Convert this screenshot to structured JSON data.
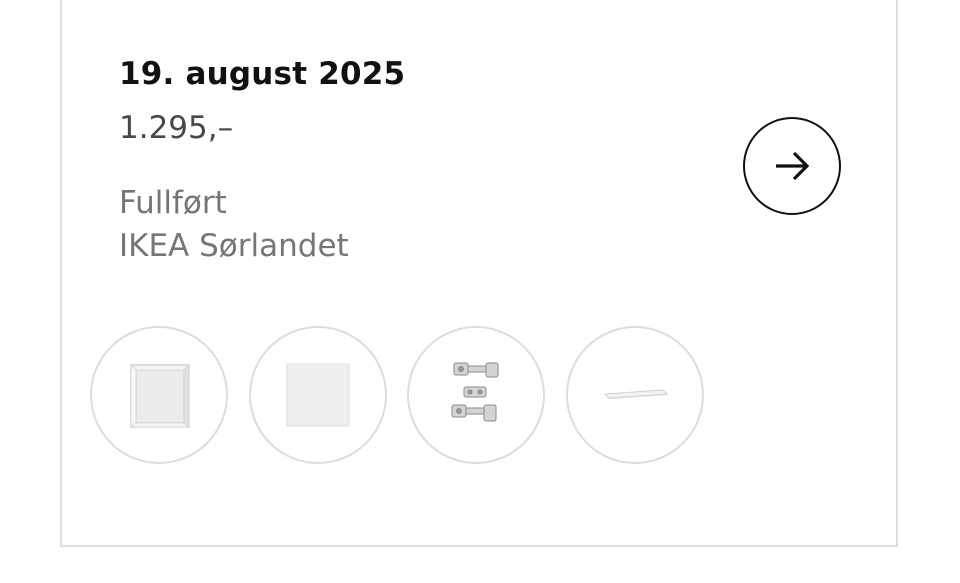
{
  "order": {
    "date": "19. august 2025",
    "price": "1.295,–",
    "status": "Fullført",
    "store": "IKEA Sørlandet"
  },
  "actions": {
    "open_icon": "arrow-right-icon"
  },
  "products": [
    {
      "icon": "cabinet-frame-icon"
    },
    {
      "icon": "door-panel-icon"
    },
    {
      "icon": "hinges-icon"
    },
    {
      "icon": "shelf-icon"
    }
  ],
  "colors": {
    "text_primary": "#111111",
    "text_secondary": "#484848",
    "text_muted": "#767676",
    "border": "#dfdfdf"
  }
}
